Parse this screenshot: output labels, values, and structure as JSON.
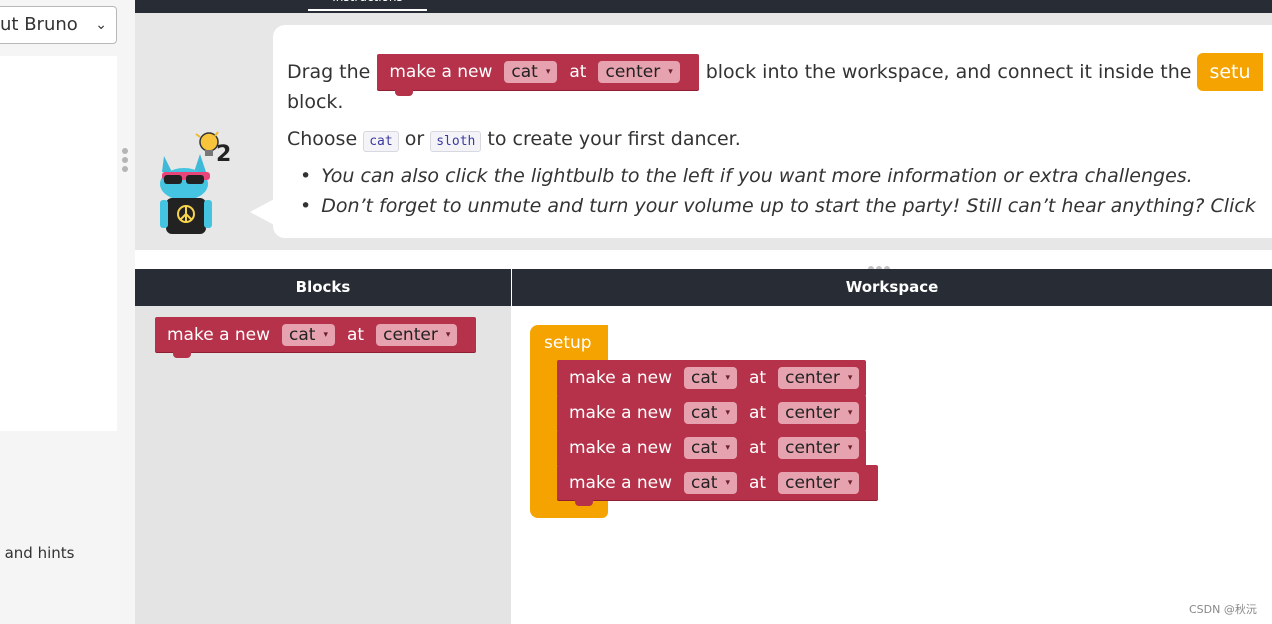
{
  "sidebar": {
    "select_value": "out Bruno",
    "select_caret": "⌄",
    "hint_text": "s and hints"
  },
  "top_tab": {
    "label": "Instructions"
  },
  "instructions": {
    "line1_prefix": "Drag the",
    "line1_suffix": "block into the workspace, and connect it inside the",
    "line1_setup": "setu",
    "line2": "block.",
    "choose_prefix": "Choose",
    "choose_code1": "cat",
    "choose_or": "or",
    "choose_code2": "sloth",
    "choose_suffix": "to create your first dancer.",
    "bullet1": "You can also click the lightbulb to the left if you want more information or extra challenges.",
    "bullet2": "Don’t forget to unmute and turn your volume up to start the party! Still can’t hear anything? Click"
  },
  "hint_count": "2",
  "headers": {
    "blocks": "Blocks",
    "workspace": "Workspace"
  },
  "block": {
    "make": "make a new",
    "dancer": "cat",
    "at": "at",
    "position": "center",
    "dropdown_arrow": "▾"
  },
  "setup_label": "setup",
  "watermark": "CSDN @秋沅",
  "colors": {
    "dark_bar": "#282c34",
    "block_red": "#b5324a",
    "field_pink": "#e6a2ae",
    "setup_orange": "#f4a300"
  }
}
